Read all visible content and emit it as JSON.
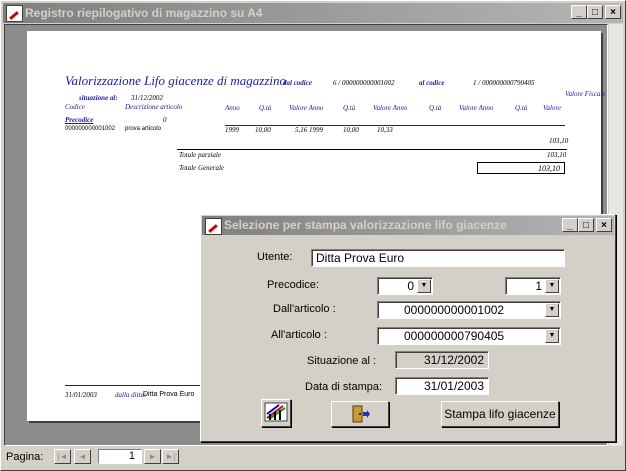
{
  "window": {
    "title": "Registro riepilogativo di magazzino su A4"
  },
  "report": {
    "heading": "Valorizzazione Lifo giacenze di magazzino",
    "dal_codice_label": "dal codice",
    "dal_codice_value": "6 / 000000000001002",
    "al_codice_label": "al codice",
    "al_codice_value": "1 / 000000000790405",
    "situazione_label": "situazione al:",
    "situazione_value": "31/12/2002",
    "valore_fiscale": "Valore Fiscale",
    "col_codice": "Codice",
    "col_descrizione": "Descrizione articolo",
    "col_anno1": "Anno",
    "col_qta1": "Q.tà",
    "col_valore_anno1": "Valore Anno",
    "col_qta2": "Q.tà",
    "col_valore_anno2": "Valore Anno",
    "col_qta3": "Q.tà",
    "col_valore_anno3": "Valore Anno",
    "col_qta4": "Q.tà",
    "col_valore": "Valore",
    "precodice_label": "Precodice",
    "precodice_value": "0",
    "row_code": "000000000001002",
    "row_desc": "prova articolo",
    "row_anno": "1999",
    "row_qta": "10,00",
    "row_valore": "5,16 1999",
    "row_qta2": "10,00",
    "row_val2": "10,33",
    "row_total": "103,10",
    "totale_parziale_label": "Totale parziale",
    "totale_parziale_value": "103,10",
    "totale_generale_label": "Totale Generale",
    "totale_generale_value": "103,10",
    "footer_date": "31/01/2003",
    "footer_ditta_label": "dalla ditta:",
    "footer_ditta_value": "Ditta Prova Euro"
  },
  "statusbar": {
    "pagina_label": "Pagina:",
    "page_number": "1"
  },
  "dialog": {
    "title": "Selezione per stampa valorizzazione lifo giacenze",
    "utente_label": "Utente:",
    "utente_value": "Ditta Prova Euro",
    "precodice_label": "Precodice:",
    "precodice_from": "0",
    "precodice_to": "1",
    "dall_articolo_label": "Dall'articolo :",
    "dall_articolo_value": "000000000001002",
    "all_articolo_label": "All'articolo :",
    "all_articolo_value": "000000000790405",
    "situazione_label": "Situazione al :",
    "situazione_value": "31/12/2002",
    "data_stampa_label": "Data di stampa:",
    "data_stampa_value": "31/01/2003",
    "stampa_button": "Stampa lifo giacenze"
  },
  "icons": {
    "app": "app-icon",
    "chart_button": "chart-icon",
    "exit_button": "exit-door-icon"
  }
}
